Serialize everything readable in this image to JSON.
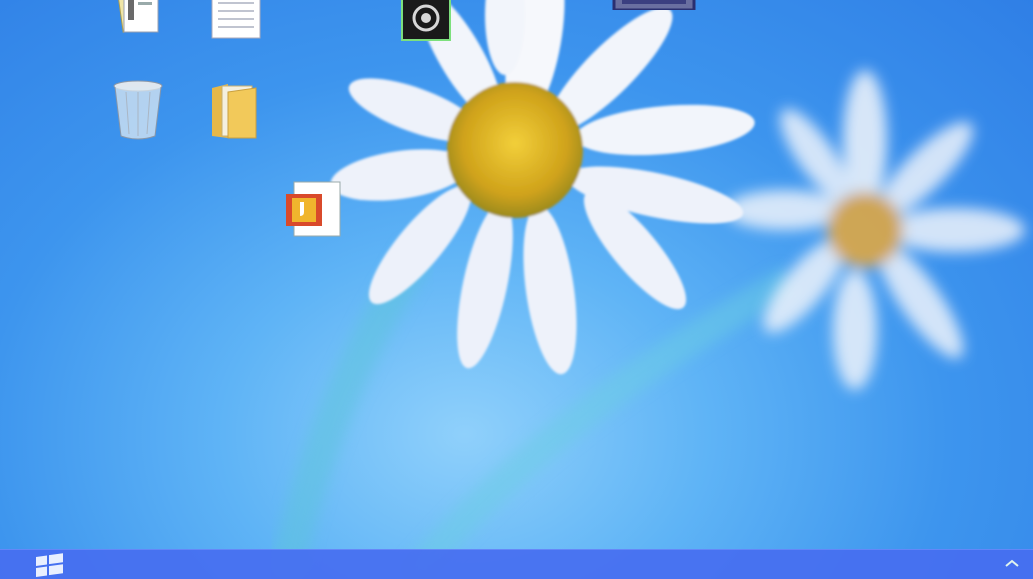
{
  "desktop": {
    "wallpaper": "daisy-flower-wallpaper",
    "background_colors": {
      "sky_center": "#8fd0fb",
      "sky_edge": "#2f7fe6",
      "petal": "#f4f6fb",
      "flower_center": "#d9b21e"
    },
    "icons": [
      {
        "name": "document-stack-icon",
        "label": ""
      },
      {
        "name": "text-document-icon",
        "label": ""
      },
      {
        "name": "qr-scanner-app-icon",
        "label": ""
      },
      {
        "name": "window-app-icon",
        "label": ""
      },
      {
        "name": "recycle-bin-icon",
        "label": ""
      },
      {
        "name": "folder-icon",
        "label": ""
      },
      {
        "name": "pdf-document-icon",
        "label": ""
      }
    ]
  },
  "taskbar": {
    "color": "#466ef0",
    "start_icon": "windows-logo-icon",
    "tray_icon": "show-hidden-icons-chevron"
  }
}
